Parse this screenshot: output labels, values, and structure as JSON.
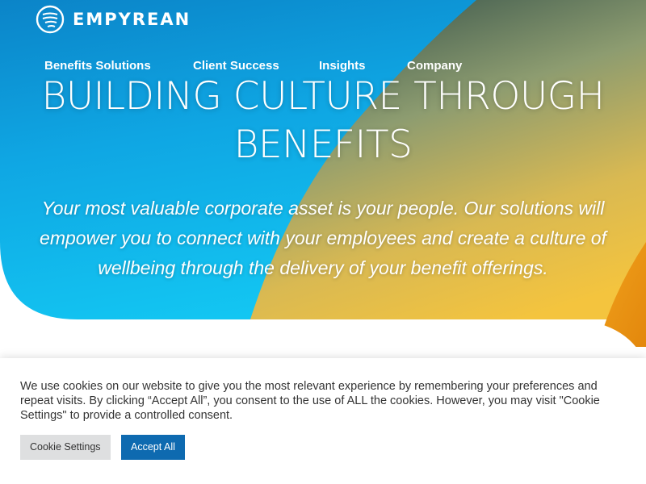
{
  "brand": {
    "name": "EMPYREAN",
    "logo_icon": "empyrean-swoosh-icon"
  },
  "nav": {
    "items": [
      {
        "label": "Benefits Solutions"
      },
      {
        "label": "Client Success"
      },
      {
        "label": "Insights"
      },
      {
        "label": "Company"
      }
    ]
  },
  "hero": {
    "headline_line1": "BUILDING CULTURE THROUGH",
    "headline_line2": "BENEFITS",
    "tagline": "Your most valuable corporate asset is your people. Our solutions will empower you to connect with your employees and create a culture of wellbeing through the delivery of your benefit offerings."
  },
  "cookie_banner": {
    "message": "We use cookies on our website to give you the most relevant experience by remembering your preferences and repeat visits. By clicking “Accept All”, you consent to the use of ALL the cookies. However, you may visit \"Cookie Settings\" to provide a controlled consent.",
    "settings_label": "Cookie Settings",
    "accept_label": "Accept All"
  },
  "colors": {
    "hero_blue": "#0fa3e0",
    "hero_cyan": "#16c4f0",
    "hero_olive": "#7f9a6a",
    "hero_gold": "#f2c046",
    "hero_orange": "#eb9412",
    "accept_button": "#0e6ab0"
  }
}
